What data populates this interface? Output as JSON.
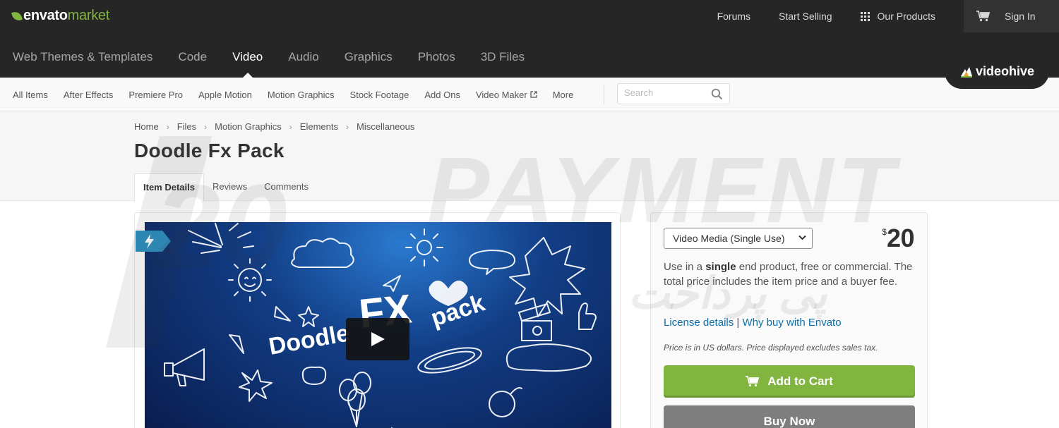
{
  "brand": {
    "name": "envato",
    "suffix": "market",
    "accent": "#82b440"
  },
  "top_links": {
    "forums": "Forums",
    "start_selling": "Start Selling",
    "our_products": "Our Products",
    "sign_in": "Sign In"
  },
  "main_nav": [
    {
      "label": "Web Themes & Templates"
    },
    {
      "label": "Code"
    },
    {
      "label": "Video",
      "active": true
    },
    {
      "label": "Audio"
    },
    {
      "label": "Graphics"
    },
    {
      "label": "Photos"
    },
    {
      "label": "3D Files"
    }
  ],
  "site_badge": "videohive",
  "sub_nav": [
    {
      "label": "All Items"
    },
    {
      "label": "After Effects"
    },
    {
      "label": "Premiere Pro"
    },
    {
      "label": "Apple Motion"
    },
    {
      "label": "Motion Graphics"
    },
    {
      "label": "Stock Footage"
    },
    {
      "label": "Add Ons"
    },
    {
      "label": "Video Maker",
      "external": true
    },
    {
      "label": "More"
    }
  ],
  "search": {
    "placeholder": "Search",
    "value": ""
  },
  "breadcrumb": [
    "Home",
    "Files",
    "Motion Graphics",
    "Elements",
    "Miscellaneous"
  ],
  "item": {
    "title": "Doodle Fx Pack"
  },
  "tabs": [
    {
      "label": "Item Details",
      "active": true
    },
    {
      "label": "Reviews"
    },
    {
      "label": "Comments"
    }
  ],
  "preview": {
    "text_left": "Doodle",
    "text_mid": "FX",
    "text_right": "pack"
  },
  "purchase": {
    "license_selected": "Video Media (Single Use)",
    "currency": "$",
    "price": "20",
    "desc_before": "Use in a ",
    "desc_bold": "single",
    "desc_after": " end product, free or commercial. The total price includes the item price and a buyer fee.",
    "license_details": "License details",
    "separator": "|",
    "why_buy": "Why buy with Envato",
    "note": "Price is in US dollars. Price displayed excludes sales tax.",
    "add_to_cart": "Add to Cart",
    "buy_now": "Buy Now"
  },
  "watermark": {
    "big_text": "PAYMENT",
    "prefix": "20",
    "script_text": "پی پرداخت"
  }
}
